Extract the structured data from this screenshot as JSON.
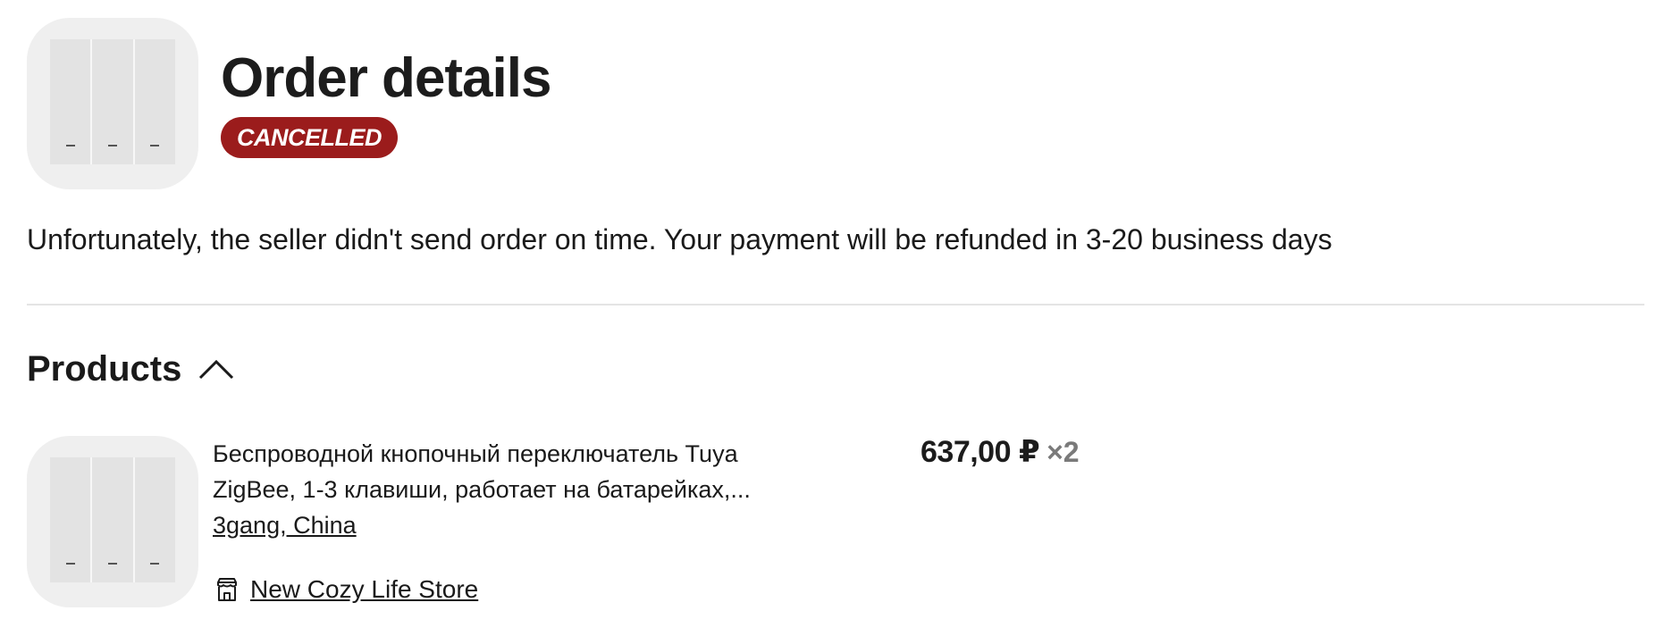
{
  "header": {
    "title": "Order details",
    "status": "CANCELLED",
    "status_color": "#9b1c1c"
  },
  "notice": "Unfortunately, the seller didn't send order on time. Your payment will be refunded in 3-20 business days",
  "products_section": {
    "title": "Products",
    "toggle_icon": "chevron-up-icon",
    "items": [
      {
        "name": "Беспроводной кнопочный переключатель Tuya ZigBee, 1-3 клавиши, работает на батарейках,...",
        "variant": "3gang, China",
        "store_icon": "store-icon",
        "store": "New Cozy Life Store",
        "price": "637,00 ₽",
        "quantity": "×2"
      }
    ]
  }
}
